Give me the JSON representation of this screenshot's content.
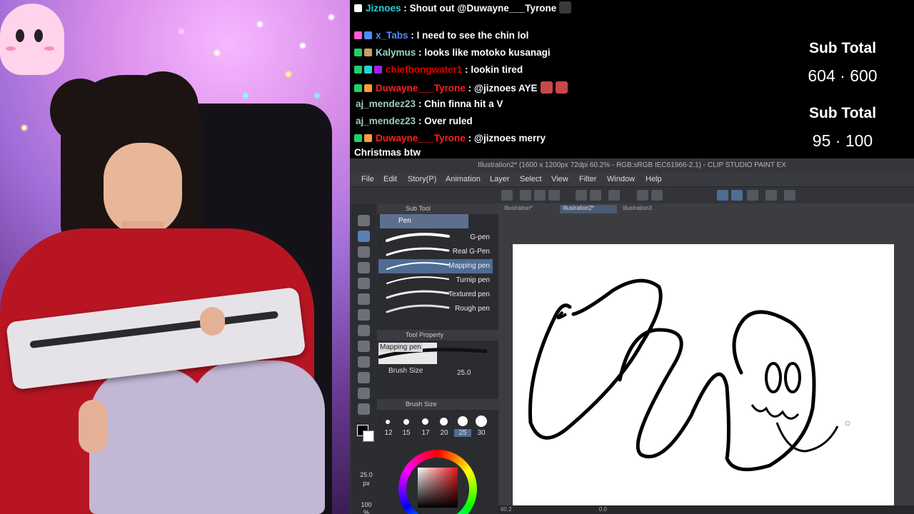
{
  "chat": {
    "lines": [
      {
        "user": "Jiznoes",
        "user_color": "#2ad1d4",
        "sep": ":",
        "msg": "Shout out @Duwayne___Tyrone"
      },
      {
        "user": "x_Tabs",
        "user_color": "#4d8cff",
        "sep": ":",
        "msg": "I need to see the chin lol"
      },
      {
        "user": "Kalymus",
        "user_color": "#9bd6c6",
        "sep": ":",
        "msg": "looks like motoko kusanagi"
      },
      {
        "user": "chiefbongwater1",
        "user_color": "#e00000",
        "sep": ":",
        "msg": "lookin tired"
      },
      {
        "user": "Duwayne___Tyrone",
        "user_color": "#ff2020",
        "sep": ":",
        "msg": "@jiznoes AYE"
      },
      {
        "user": "aj_mendez23",
        "user_color": "#9ec9c0",
        "sep": ":",
        "msg": "Chin finna hit a V"
      },
      {
        "user": "aj_mendez23",
        "user_color": "#9ec9c0",
        "sep": ":",
        "msg": "Over ruled"
      },
      {
        "user": "Duwayne___Tyrone",
        "user_color": "#ff2020",
        "sep": ":",
        "msg": "@jiznoes merry"
      }
    ],
    "wrap": "Christmas btw"
  },
  "subs": [
    {
      "label": "Sub Total",
      "value": "604 · 600"
    },
    {
      "label": "Sub Total",
      "value": "95 · 100"
    }
  ],
  "app": {
    "title": "Illustration2* (1600 x 1200px 72dpi 60.2% - RGB:sRGB IEC61966-2.1) - CLIP STUDIO PAINT EX",
    "menu": [
      "File",
      "Edit",
      "Story(P)",
      "Animation",
      "Layer",
      "Select",
      "View",
      "Filter",
      "Window",
      "Help"
    ],
    "doc_tabs": [
      "Illustration*",
      "Illustration2*",
      "Illustration3"
    ],
    "subtool_header": "Sub Tool",
    "pen_group": "Pen",
    "brushes": [
      "G-pen",
      "Real G-Pen",
      "Mapping pen",
      "Turnip pen",
      "Textured pen",
      "Rough pen"
    ],
    "selected_brush": "Mapping pen",
    "tool_property_header": "Tool Property",
    "property_name": "Mapping pen",
    "brush_size_label": "Brush Size",
    "brush_size_value": "25.0",
    "brush_size_header": "Brush Size",
    "size_presets": [
      "12",
      "15",
      "17",
      "20",
      "25",
      "30"
    ],
    "selected_size": "25",
    "side_size": "25.0",
    "side_unit": "px",
    "side_opacity": "100",
    "side_opacity_unit": "%",
    "status_zoom": "60.2",
    "status_rot": "0.0"
  }
}
